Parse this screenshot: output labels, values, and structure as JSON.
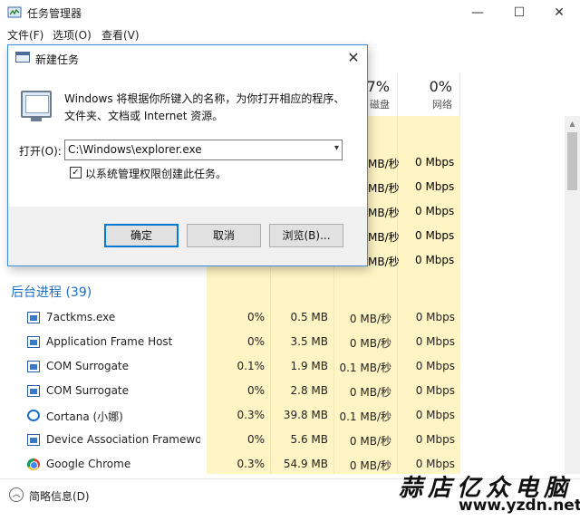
{
  "taskmanager": {
    "title": "任务管理器",
    "menu": [
      "文件(F)",
      "选项(O)",
      "查看(V)"
    ],
    "window_controls": {
      "minimize": "—",
      "maximize": "☐",
      "close": "✕"
    },
    "columns": {
      "disk": {
        "percent": "7%",
        "label": "磁盘"
      },
      "network": {
        "percent": "0%",
        "label": "网络"
      }
    },
    "upper_rows": [
      {
        "disk": "MB/秒",
        "net": "0 Mbps"
      },
      {
        "disk": "MB/秒",
        "net": "0 Mbps"
      },
      {
        "disk": "MB/秒",
        "net": "0 Mbps"
      },
      {
        "disk": "MB/秒",
        "net": "0 Mbps"
      },
      {
        "disk": "MB/秒",
        "net": "0 Mbps"
      }
    ],
    "section_title": "后台进程 (39)",
    "processes": [
      {
        "name": "7actkms.exe",
        "icon": "app-window-icon",
        "cpu": "0%",
        "mem": "0.5 MB",
        "disk": "0 MB/秒",
        "net": "0 Mbps"
      },
      {
        "name": "Application Frame Host",
        "icon": "app-window-icon",
        "cpu": "0%",
        "mem": "3.5 MB",
        "disk": "0 MB/秒",
        "net": "0 Mbps"
      },
      {
        "name": "COM Surrogate",
        "icon": "app-window-icon",
        "cpu": "0.1%",
        "mem": "1.9 MB",
        "disk": "0.1 MB/秒",
        "net": "0 Mbps"
      },
      {
        "name": "COM Surrogate",
        "icon": "app-window-icon",
        "cpu": "0%",
        "mem": "2.8 MB",
        "disk": "0 MB/秒",
        "net": "0 Mbps"
      },
      {
        "name": "Cortana (小娜)",
        "icon": "cortana-icon",
        "cpu": "0.3%",
        "mem": "39.8 MB",
        "disk": "0.1 MB/秒",
        "net": "0 Mbps"
      },
      {
        "name": "Device Association Framewo...",
        "icon": "app-window-icon",
        "cpu": "0%",
        "mem": "5.6 MB",
        "disk": "0 MB/秒",
        "net": "0 Mbps"
      },
      {
        "name": "Google Chrome",
        "icon": "chrome-icon",
        "cpu": "0.3%",
        "mem": "54.9 MB",
        "disk": "0 MB/秒",
        "net": "0 Mbps"
      }
    ],
    "footer_label": "简略信息(D)"
  },
  "run_dialog": {
    "title": "新建任务",
    "close": "✕",
    "description": "Windows 将根据你所键入的名称，为你打开相应的程序、文件夹、文档或 Internet 资源。",
    "open_label": "打开(O):",
    "open_value": "C:\\Windows\\explorer.exe",
    "admin_checked": "✓",
    "admin_label": "以系统管理权限创建此任务。",
    "buttons": {
      "ok": "确定",
      "cancel": "取消",
      "browse": "浏览(B)..."
    }
  },
  "watermark": {
    "text": "蒜店亿众电脑",
    "url": "www.yzdn.net"
  },
  "colors": {
    "accent": "#0078d7",
    "section_blue": "#1e6fc8",
    "column_shade": "#fff4c4"
  }
}
